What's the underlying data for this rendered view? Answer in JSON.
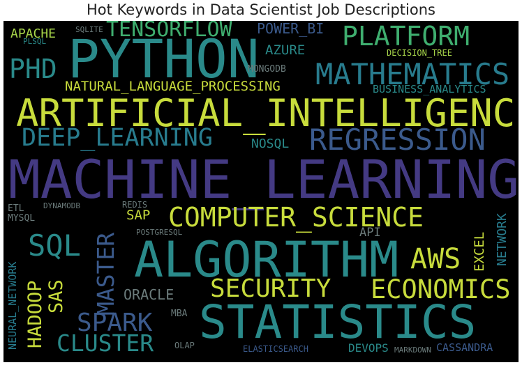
{
  "title": "Hot Keywords in Data Scientist Job Descriptions",
  "colors": {
    "background": "#000000",
    "yellow": "#c8dc3c",
    "lime": "#a8d64a",
    "teal": "#2a8a8a",
    "teal2": "#287c8e",
    "blue": "#3b5a8c",
    "purple": "#443a83",
    "green": "#3fae6f",
    "grey": "#6b7b7b"
  },
  "words": {
    "apache": "APACHE",
    "plsql": "PLSQL",
    "sqlite": "SQLITE",
    "tensorflow": "TENSORFLOW",
    "power_bi": "POWER_BI",
    "platform": "PLATFORM",
    "python": "PYTHON",
    "azure": "AZURE",
    "decision_tree": "DECISION_TREE",
    "phd": "PHD",
    "mongodb": "MONGODB",
    "mathematics": "MATHEMATICS",
    "nlp": "NATURAL_LANGUAGE_PROCESSING",
    "business_analytics": "BUSINESS_ANALYTICS",
    "ai": "ARTIFICIAL_INTELLIGENCE",
    "deep_learning": "DEEP_LEARNING",
    "regression": "REGRESSION",
    "nosql": "NOSQL",
    "machine_learning": "MACHINE_LEARNING",
    "etl": "ETL",
    "dynamodb": "DYNAMODB",
    "redis": "REDIS",
    "mysql": "MYSQL",
    "sap": "SAP",
    "computer_science": "COMPUTER_SCIENCE",
    "network": "NETWORK",
    "sql": "SQL",
    "master": "MASTER",
    "postgresql": "POSTGRESQL",
    "api": "API",
    "neural_network": "NEURAL_NETWORK",
    "algorithm": "ALGORITHM",
    "aws": "AWS",
    "excel": "EXCEL",
    "hadoop": "HADOOP",
    "sas": "SAS",
    "oracle": "ORACLE",
    "security": "SECURITY",
    "economics": "ECONOMICS",
    "spark": "SPARK",
    "mba": "MBA",
    "statistics": "STATISTICS",
    "cluster": "CLUSTER",
    "olap": "OLAP",
    "elasticsearch": "ELASTICSEARCH",
    "devops": "DEVOPS",
    "markdown": "MARKDOWN",
    "cassandra": "CASSANDRA"
  }
}
